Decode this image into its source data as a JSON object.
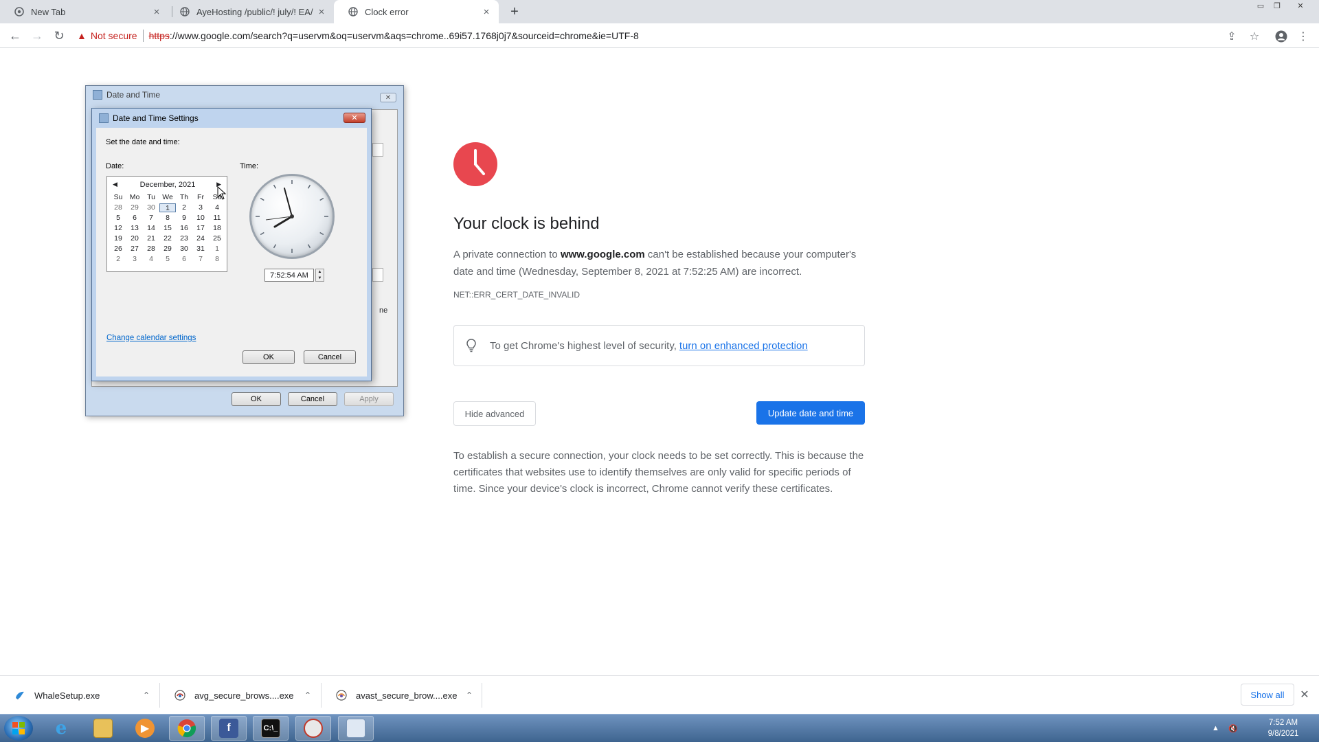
{
  "tabs": [
    {
      "title": "New Tab",
      "icon": "chrome-newtab-icon"
    },
    {
      "title": "AyeHosting /public/! july/! EA/",
      "icon": "globe-icon"
    },
    {
      "title": "Clock error",
      "icon": "globe-icon"
    }
  ],
  "omnibox": {
    "security_label": "Not secure",
    "scheme": "https",
    "url_rest": "://www.google.com/search?q=uservm&oq=uservm&aqs=chrome..69i57.1768j0j7&sourceid=chrome&ie=UTF-8"
  },
  "error": {
    "title": "Your clock is behind",
    "desc_pre": "A private connection to ",
    "domain": "www.google.com",
    "desc_post": " can't be established because your computer's date and time (Wednesday, September 8, 2021 at 7:52:25 AM) are incorrect.",
    "code": "NET::ERR_CERT_DATE_INVALID",
    "tip_text": "To get Chrome's highest level of security,",
    "tip_link": "turn on enhanced protection",
    "hide_button": "Hide advanced",
    "update_button": "Update date and time",
    "explain": "To establish a secure connection, your clock needs to be set correctly. This is because the certificates that websites use to identify themselves are only valid for specific periods of time. Since your device's clock is incorrect, Chrome cannot verify these certificates.",
    "accent_color": "#e8474f",
    "button_color": "#1a73e8"
  },
  "outer_dialog": {
    "title": "Date and Time",
    "ok": "OK",
    "cancel": "Cancel",
    "apply": "Apply",
    "partial_text": "ne"
  },
  "inner_dialog": {
    "title": "Date and Time Settings",
    "instruction": "Set the date and time:",
    "date_label": "Date:",
    "time_label": "Time:",
    "month": "December, 2021",
    "weekdays": [
      "Su",
      "Mo",
      "Tu",
      "We",
      "Th",
      "Fr",
      "Sa"
    ],
    "days": [
      [
        "28",
        "29",
        "30",
        "1",
        "2",
        "3",
        "4"
      ],
      [
        "5",
        "6",
        "7",
        "8",
        "9",
        "10",
        "11"
      ],
      [
        "12",
        "13",
        "14",
        "15",
        "16",
        "17",
        "18"
      ],
      [
        "19",
        "20",
        "21",
        "22",
        "23",
        "24",
        "25"
      ],
      [
        "26",
        "27",
        "28",
        "29",
        "30",
        "31",
        "1"
      ],
      [
        "2",
        "3",
        "4",
        "5",
        "6",
        "7",
        "8"
      ]
    ],
    "selected_day": "1",
    "time_value": "7:52:54 AM",
    "calendar_link": "Change calendar settings",
    "ok": "OK",
    "cancel": "Cancel"
  },
  "downloads": [
    {
      "name": "WhaleSetup.exe",
      "icon": "whale-icon"
    },
    {
      "name": "avg_secure_brows....exe",
      "icon": "avg-icon"
    },
    {
      "name": "avast_secure_brow....exe",
      "icon": "avast-icon"
    }
  ],
  "shelf": {
    "show_all": "Show all"
  },
  "taskbar": {
    "apps": [
      "internet-explorer-icon",
      "file-explorer-icon",
      "media-player-icon",
      "chrome-icon",
      "facebook-icon",
      "cmd-icon",
      "avast-app-icon",
      "date-time-app-icon"
    ],
    "time": "7:52 AM",
    "date": "9/8/2021"
  }
}
